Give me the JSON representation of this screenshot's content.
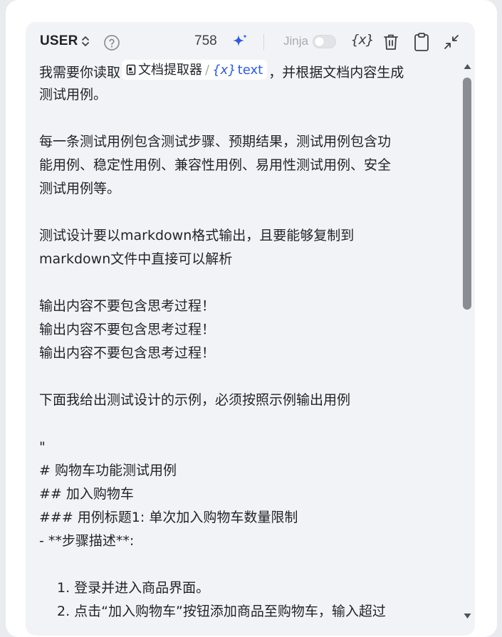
{
  "header": {
    "role_label": "USER",
    "token_count": "758",
    "jinja_label": "Jinja",
    "jinja_enabled": false,
    "variable_button": "{x}"
  },
  "content": {
    "line1_before": "我需要你读取",
    "ref": {
      "name": "文档提取器",
      "separator": "/",
      "var_symbol": "{x}",
      "var_name": "text"
    },
    "line1_after": "，并根据文档内容生成",
    "lines": [
      "测试用例。",
      "每一条测试用例包含测试步骤、预期结果，测试用例包含功",
      "能用例、稳定性用例、兼容性用例、易用性测试用例、安全",
      "测试用例等。",
      "测试设计要以markdown格式输出，且要能够复制到",
      "markdown文件中直接可以解析",
      "输出内容不要包含思考过程！",
      "输出内容不要包含思考过程！",
      "输出内容不要包含思考过程！",
      "下面我给出测试设计的示例，必须按照示例输出用例",
      "\"",
      "# 购物车功能测试用例",
      "## 加入购物车",
      "### 用例标题1: 单次加入购物车数量限制",
      "- **步骤描述**:",
      "1. 登录并进入商品界面。",
      "2. 点击“加入购物车”按钮添加商品至购物车，输入超过"
    ]
  },
  "colors": {
    "accent": "#2d5be3",
    "panel_bg": "#f2f3f7",
    "text": "#1f2329",
    "scroll_thumb": "#8a8d93"
  },
  "icons": [
    "chevron-updown-icon",
    "help-circle-icon",
    "sparkle-icon",
    "trash-icon",
    "clipboard-icon",
    "collapse-icon",
    "document-icon",
    "arrow-up-icon",
    "arrow-down-icon"
  ]
}
